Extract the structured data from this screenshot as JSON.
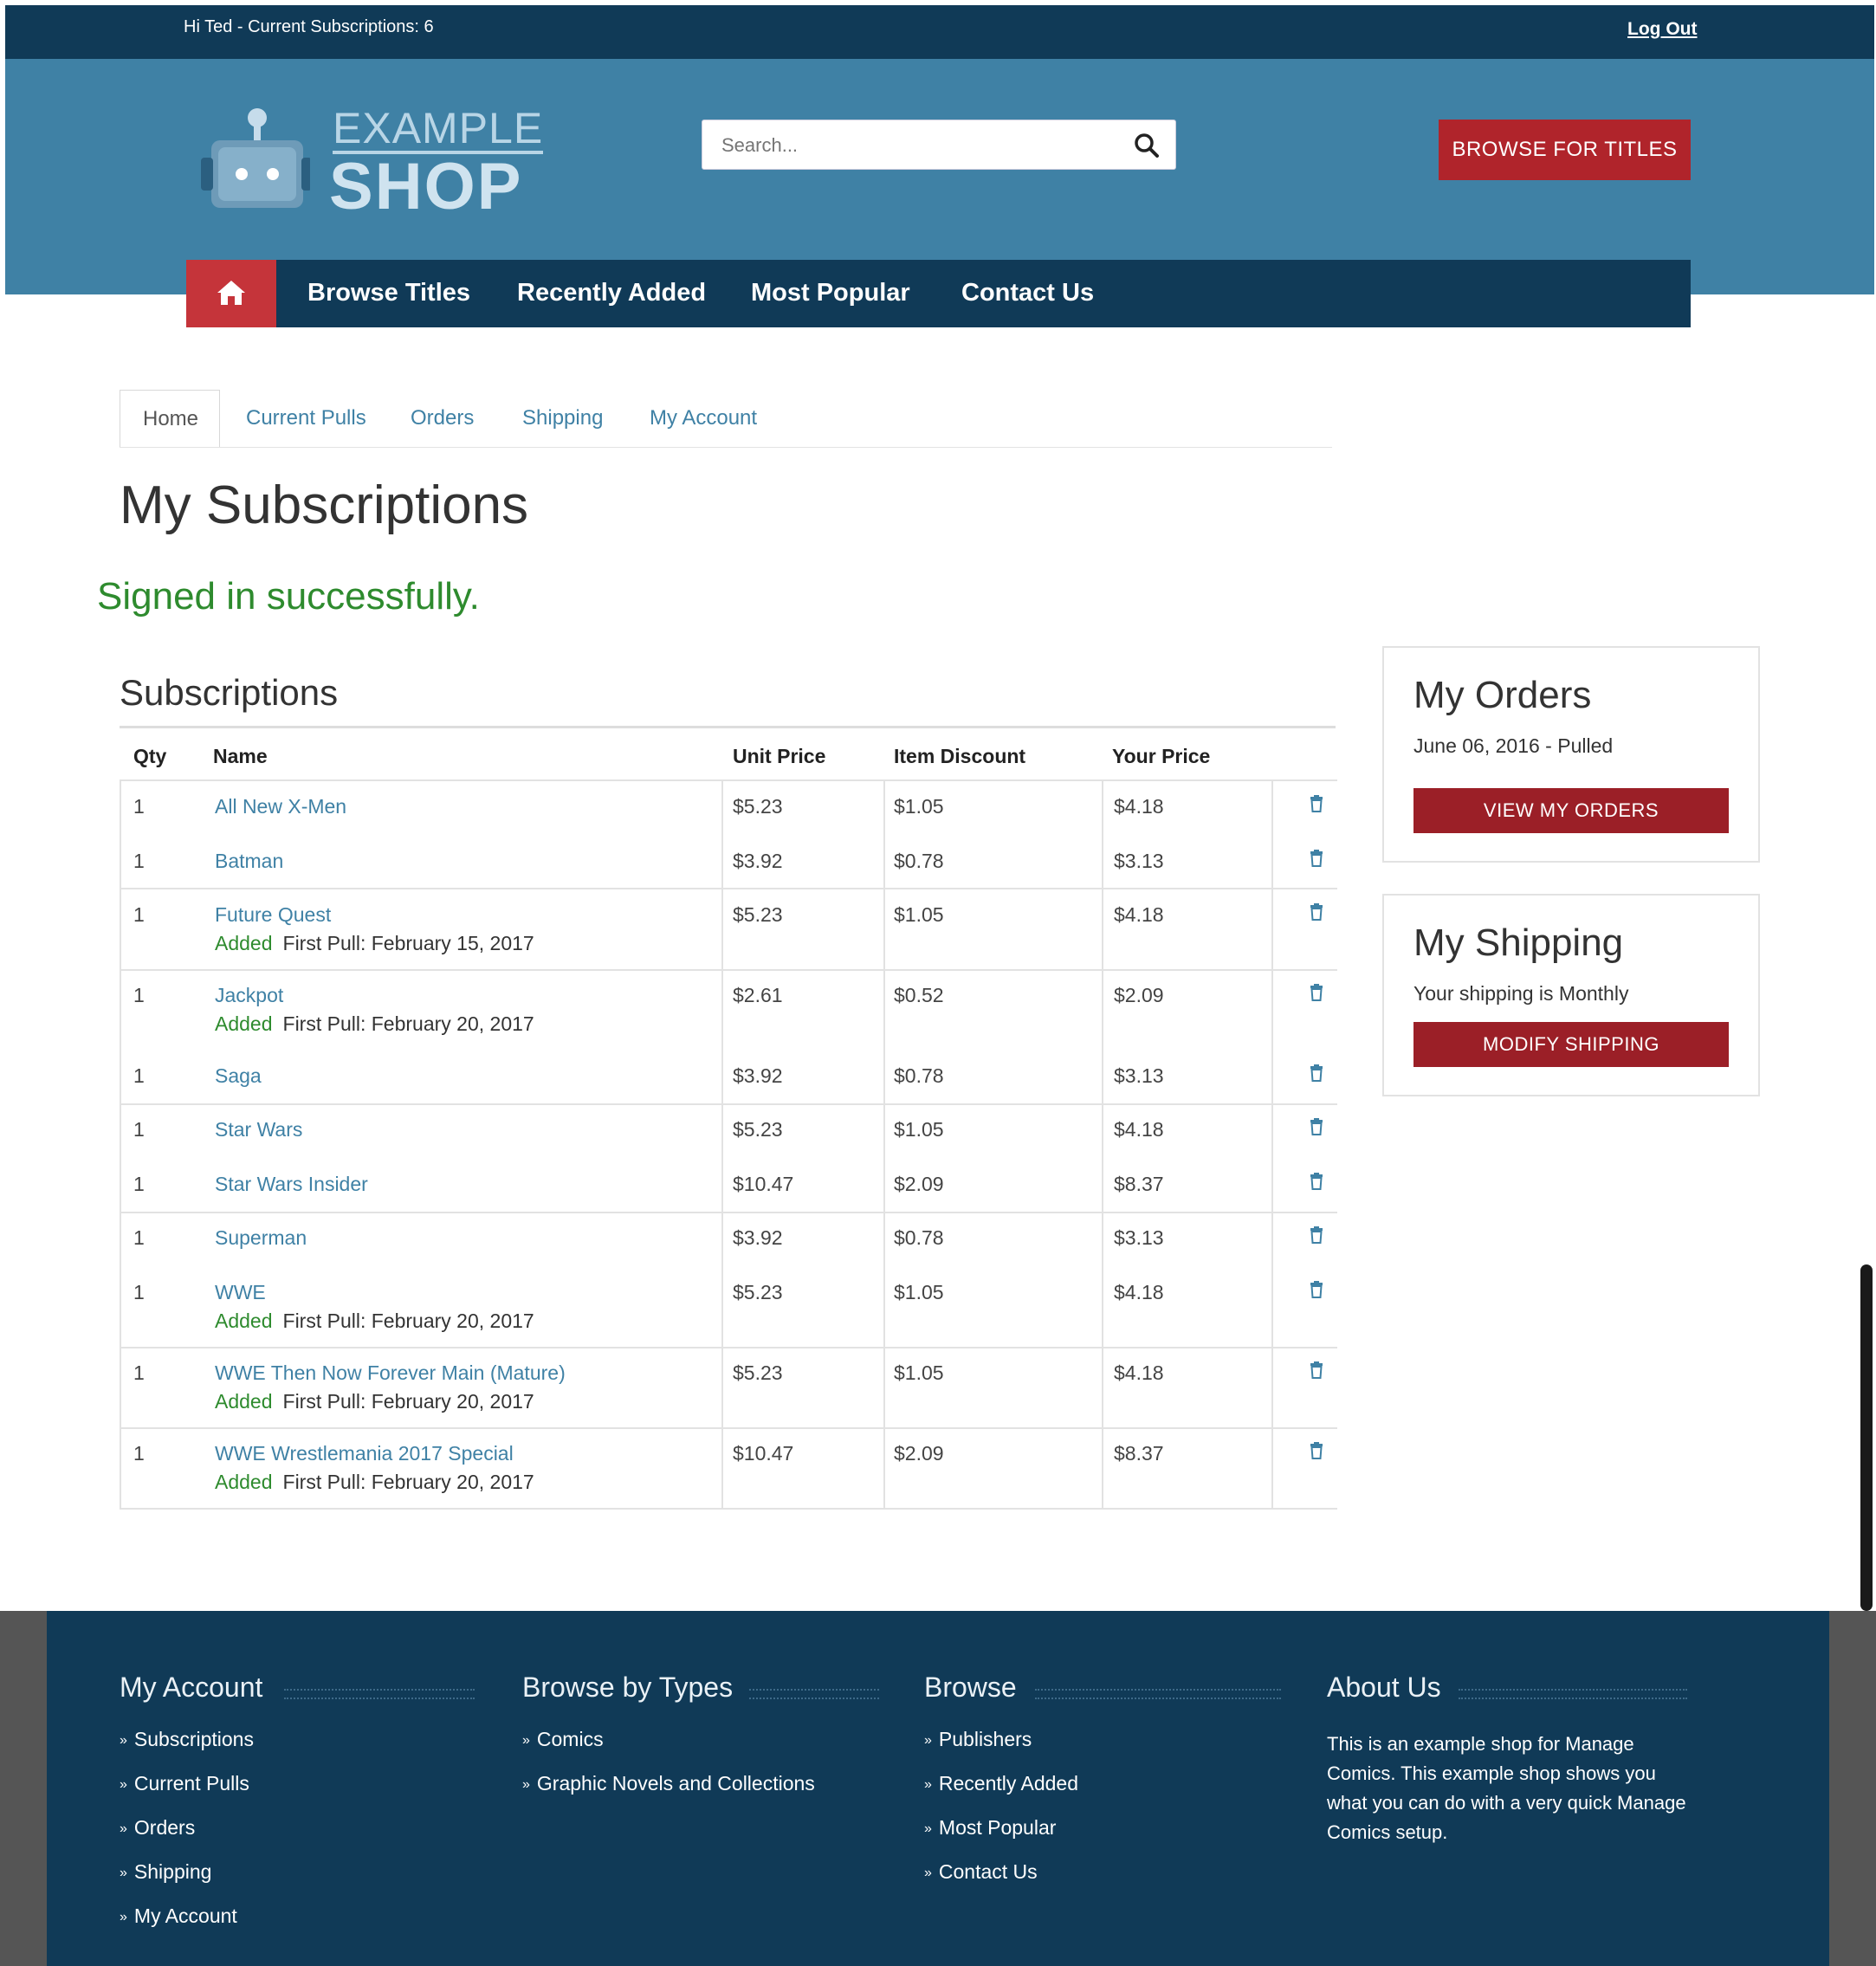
{
  "topbar": {
    "greeting": "Hi Ted - Current Subscriptions: 6",
    "logout": "Log Out"
  },
  "brand": {
    "line1": "EXAMPLE",
    "line2": "SHOP"
  },
  "search": {
    "placeholder": "Search..."
  },
  "browse_button": "BROWSE FOR TITLES",
  "nav": [
    "Browse Titles",
    "Recently Added",
    "Most Popular",
    "Contact Us"
  ],
  "tabs": [
    "Home",
    "Current Pulls",
    "Orders",
    "Shipping",
    "My Account"
  ],
  "page_title": "My Subscriptions",
  "flash": "Signed in successfully.",
  "subscriptions": {
    "title": "Subscriptions",
    "headers": [
      "Qty",
      "Name",
      "Unit Price",
      "Item Discount",
      "Your Price"
    ],
    "added_label": "Added",
    "first_pull_label": "First Pull:",
    "rows": [
      {
        "qty": "1",
        "name": "All New X-Men",
        "unit": "$5.23",
        "disc": "$1.05",
        "price": "$4.18"
      },
      {
        "qty": "1",
        "name": "Batman",
        "unit": "$3.92",
        "disc": "$0.78",
        "price": "$3.13"
      },
      {
        "qty": "1",
        "name": "Future Quest",
        "unit": "$5.23",
        "disc": "$1.05",
        "price": "$4.18",
        "first_pull": "February 15, 2017"
      },
      {
        "qty": "1",
        "name": "Jackpot",
        "unit": "$2.61",
        "disc": "$0.52",
        "price": "$2.09",
        "first_pull": "February 20, 2017"
      },
      {
        "qty": "1",
        "name": "Saga",
        "unit": "$3.92",
        "disc": "$0.78",
        "price": "$3.13"
      },
      {
        "qty": "1",
        "name": "Star Wars",
        "unit": "$5.23",
        "disc": "$1.05",
        "price": "$4.18"
      },
      {
        "qty": "1",
        "name": "Star Wars Insider",
        "unit": "$10.47",
        "disc": "$2.09",
        "price": "$8.37"
      },
      {
        "qty": "1",
        "name": "Superman",
        "unit": "$3.92",
        "disc": "$0.78",
        "price": "$3.13"
      },
      {
        "qty": "1",
        "name": "WWE",
        "unit": "$5.23",
        "disc": "$1.05",
        "price": "$4.18",
        "first_pull": "February 20, 2017"
      },
      {
        "qty": "1",
        "name": "WWE Then Now Forever Main (Mature)",
        "unit": "$5.23",
        "disc": "$1.05",
        "price": "$4.18",
        "first_pull": "February 20, 2017"
      },
      {
        "qty": "1",
        "name": "WWE Wrestlemania 2017 Special",
        "unit": "$10.47",
        "disc": "$2.09",
        "price": "$8.37",
        "first_pull": "February 20, 2017"
      }
    ]
  },
  "orders_box": {
    "title": "My Orders",
    "text": "June 06, 2016 - Pulled",
    "button": "VIEW MY ORDERS"
  },
  "shipping_box": {
    "title": "My Shipping",
    "text": "Your shipping is Monthly",
    "button": "MODIFY SHIPPING"
  },
  "footer": {
    "my_account": {
      "title": "My Account",
      "links": [
        "Subscriptions",
        "Current Pulls",
        "Orders",
        "Shipping",
        "My Account"
      ]
    },
    "browse_types": {
      "title": "Browse by Types",
      "links": [
        "Comics",
        "Graphic Novels and Collections"
      ]
    },
    "browse": {
      "title": "Browse",
      "links": [
        "Publishers",
        "Recently Added",
        "Most Popular",
        "Contact Us"
      ]
    },
    "about": {
      "title": "About Us",
      "text": "This is an example shop for Manage Comics. This example shop shows you what you can do with a very quick Manage Comics setup."
    }
  },
  "colors": {
    "dark_navy": "#103a57",
    "header_blue": "#3f81a5",
    "brand_red": "#b0242b",
    "success_green": "#2e8b2e"
  }
}
